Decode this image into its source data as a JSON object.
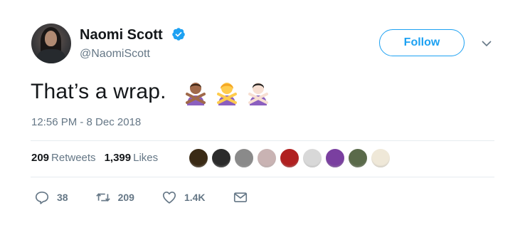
{
  "user": {
    "name": "Naomi Scott",
    "handle": "@NaomiScott",
    "follow_label": "Follow"
  },
  "tweet": {
    "text": "That’s a wrap.",
    "timestamp": "12:56 PM - 8 Dec 2018",
    "emojis": [
      "person-gesturing-no-medium-dark",
      "person-gesturing-no-yellow",
      "person-gesturing-no-light"
    ]
  },
  "stats": {
    "retweets_count": "209",
    "retweets_label": "Retweets",
    "likes_count": "1,399",
    "likes_label": "Likes"
  },
  "actions": {
    "reply_count": "38",
    "retweet_count": "209",
    "like_count": "1.4K"
  },
  "colors": {
    "accent": "#1da1f2",
    "muted": "#657786",
    "divider": "#e6ecf0",
    "emoji_shirt": "#8b5fbf"
  },
  "liker_colors": [
    "#3a2a15",
    "#2b2b2b",
    "#8a8a8a",
    "#c9b3b3",
    "#b02020",
    "#d8d8d8",
    "#7a3fa0",
    "#5a6a4a",
    "#efe8d8"
  ]
}
